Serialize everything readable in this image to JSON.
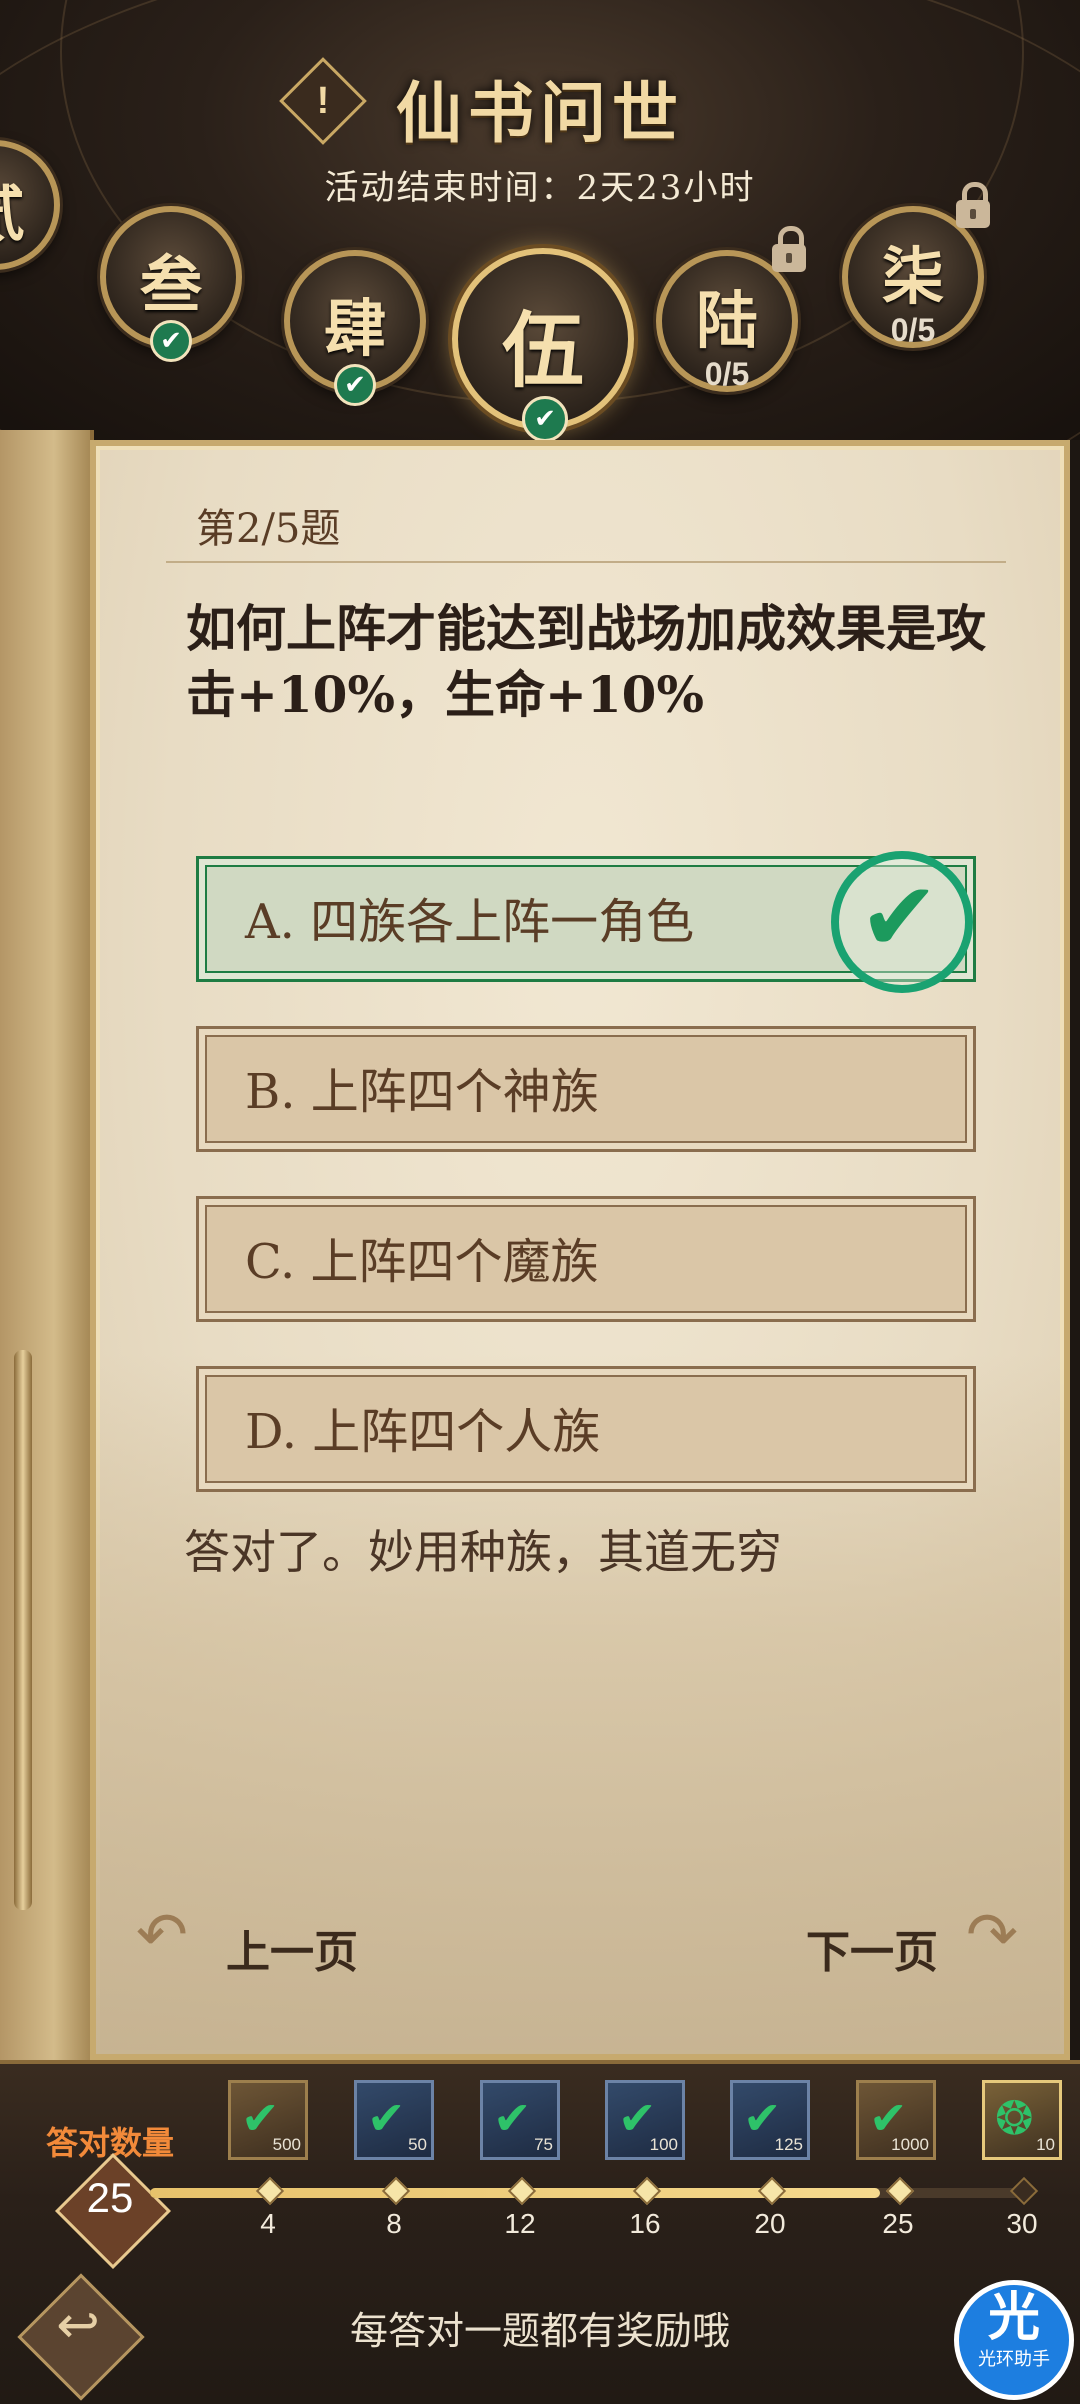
{
  "header": {
    "title": "仙书问世",
    "alert_icon_glyph": "!",
    "subtitle": "活动结束时间：2天23小时",
    "chapters": [
      {
        "label": "贰",
        "state": "completed"
      },
      {
        "label": "叁",
        "state": "completed"
      },
      {
        "label": "肆",
        "state": "completed"
      },
      {
        "label": "伍",
        "state": "current-completed"
      },
      {
        "label": "陆",
        "state": "locked",
        "progress": "0/5"
      },
      {
        "label": "柒",
        "state": "locked",
        "progress": "0/5"
      }
    ],
    "check_glyph": "✔"
  },
  "question": {
    "index": "第2/5题",
    "text": "如何上阵才能达到战场加成效果是攻击+10%，生命+10%",
    "options": [
      {
        "label": "A. 四族各上阵一角色",
        "state": "correct"
      },
      {
        "label": "B. 上阵四个神族",
        "state": "normal"
      },
      {
        "label": "C. 上阵四个魔族",
        "state": "normal"
      },
      {
        "label": "D. 上阵四个人族",
        "state": "normal"
      }
    ],
    "correct_mark_glyph": "✔",
    "feedback": "答对了。妙用种族，其道无穷"
  },
  "nav": {
    "prev": "上一页",
    "next": "下一页",
    "prev_arrow": "↶",
    "next_arrow": "↷"
  },
  "progress": {
    "label": "答对数量",
    "value": "25",
    "correct_count": 25,
    "max": 30,
    "milestones": [
      "4",
      "8",
      "12",
      "16",
      "20",
      "25",
      "30"
    ],
    "rewards": [
      {
        "qty": "500",
        "kind": "gold"
      },
      {
        "qty": "50",
        "kind": "blue"
      },
      {
        "qty": "75",
        "kind": "blue"
      },
      {
        "qty": "100",
        "kind": "blue"
      },
      {
        "qty": "125",
        "kind": "blue"
      },
      {
        "qty": "1000",
        "kind": "gold"
      },
      {
        "qty": "10",
        "kind": "jade"
      }
    ],
    "reward_glyph": "✔",
    "jade_glyph": "❂"
  },
  "footer": {
    "back_glyph": "↩",
    "hint": "每答对一题都有奖励哦"
  },
  "watermark": {
    "big": "光",
    "small": "光环助手"
  },
  "colors": {
    "correct_green": "#1e7c43",
    "accent_gold": "#c7aa6e",
    "count_orange": "#f28a3a"
  }
}
